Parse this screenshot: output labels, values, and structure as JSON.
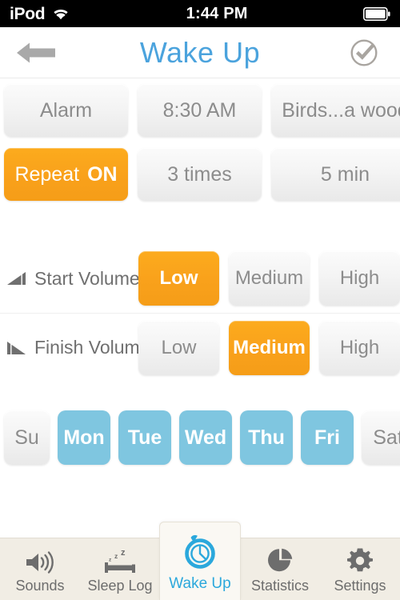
{
  "status_bar": {
    "carrier": "iPod",
    "wifi_icon": "wifi-icon",
    "time": "1:44 PM",
    "battery_icon": "battery-full-icon"
  },
  "header": {
    "back_icon": "back-arrow-icon",
    "title": "Wake Up",
    "done_icon": "check-circle-icon",
    "title_color": "#4ba3dd"
  },
  "colors": {
    "accent_orange": "#f9a11b",
    "accent_blue": "#7fc6e0",
    "tab_active_blue": "#2ba8dc",
    "tabbar_bg": "#f1ede4",
    "pill_text": "#8c8c8c"
  },
  "settings": {
    "row1": [
      {
        "name": "alarm-button",
        "label": "Alarm",
        "selected": false
      },
      {
        "name": "time-button",
        "label": "8:30 AM",
        "selected": false
      },
      {
        "name": "sound-button",
        "label": "Birds...a wood",
        "selected": false
      }
    ],
    "row2": [
      {
        "name": "repeat-button",
        "label_light": "Repeat",
        "label_bold": "ON",
        "selected": true
      },
      {
        "name": "repeat-count-button",
        "label": "3 times",
        "selected": false
      },
      {
        "name": "repeat-interval-button",
        "label": "5 min",
        "selected": false
      }
    ]
  },
  "volume": {
    "start": {
      "icon": "volume-increase-icon",
      "label": "Start Volume",
      "options": [
        {
          "label": "Low",
          "selected": true
        },
        {
          "label": "Medium",
          "selected": false
        },
        {
          "label": "High",
          "selected": false
        }
      ]
    },
    "finish": {
      "icon": "volume-decrease-icon",
      "label": "Finish Volume",
      "options": [
        {
          "label": "Low",
          "selected": false
        },
        {
          "label": "Medium",
          "selected": true
        },
        {
          "label": "High",
          "selected": false
        }
      ]
    }
  },
  "days": [
    {
      "label": "Su",
      "selected": false
    },
    {
      "label": "Mon",
      "selected": true
    },
    {
      "label": "Tue",
      "selected": true
    },
    {
      "label": "Wed",
      "selected": true
    },
    {
      "label": "Thu",
      "selected": true
    },
    {
      "label": "Fri",
      "selected": true
    },
    {
      "label": "Sat",
      "selected": false
    }
  ],
  "tabbar": {
    "items": [
      {
        "name": "tab-sounds",
        "label": "Sounds",
        "icon": "speaker-icon",
        "active": false
      },
      {
        "name": "tab-sleep-log",
        "label": "Sleep Log",
        "icon": "bed-sleep-icon",
        "active": false
      },
      {
        "name": "tab-wake-up",
        "label": "Wake Up",
        "icon": "alarm-clock-icon",
        "active": true
      },
      {
        "name": "tab-statistics",
        "label": "Statistics",
        "icon": "pie-chart-icon",
        "active": false
      },
      {
        "name": "tab-settings",
        "label": "Settings",
        "icon": "gear-icon",
        "active": false
      }
    ]
  }
}
